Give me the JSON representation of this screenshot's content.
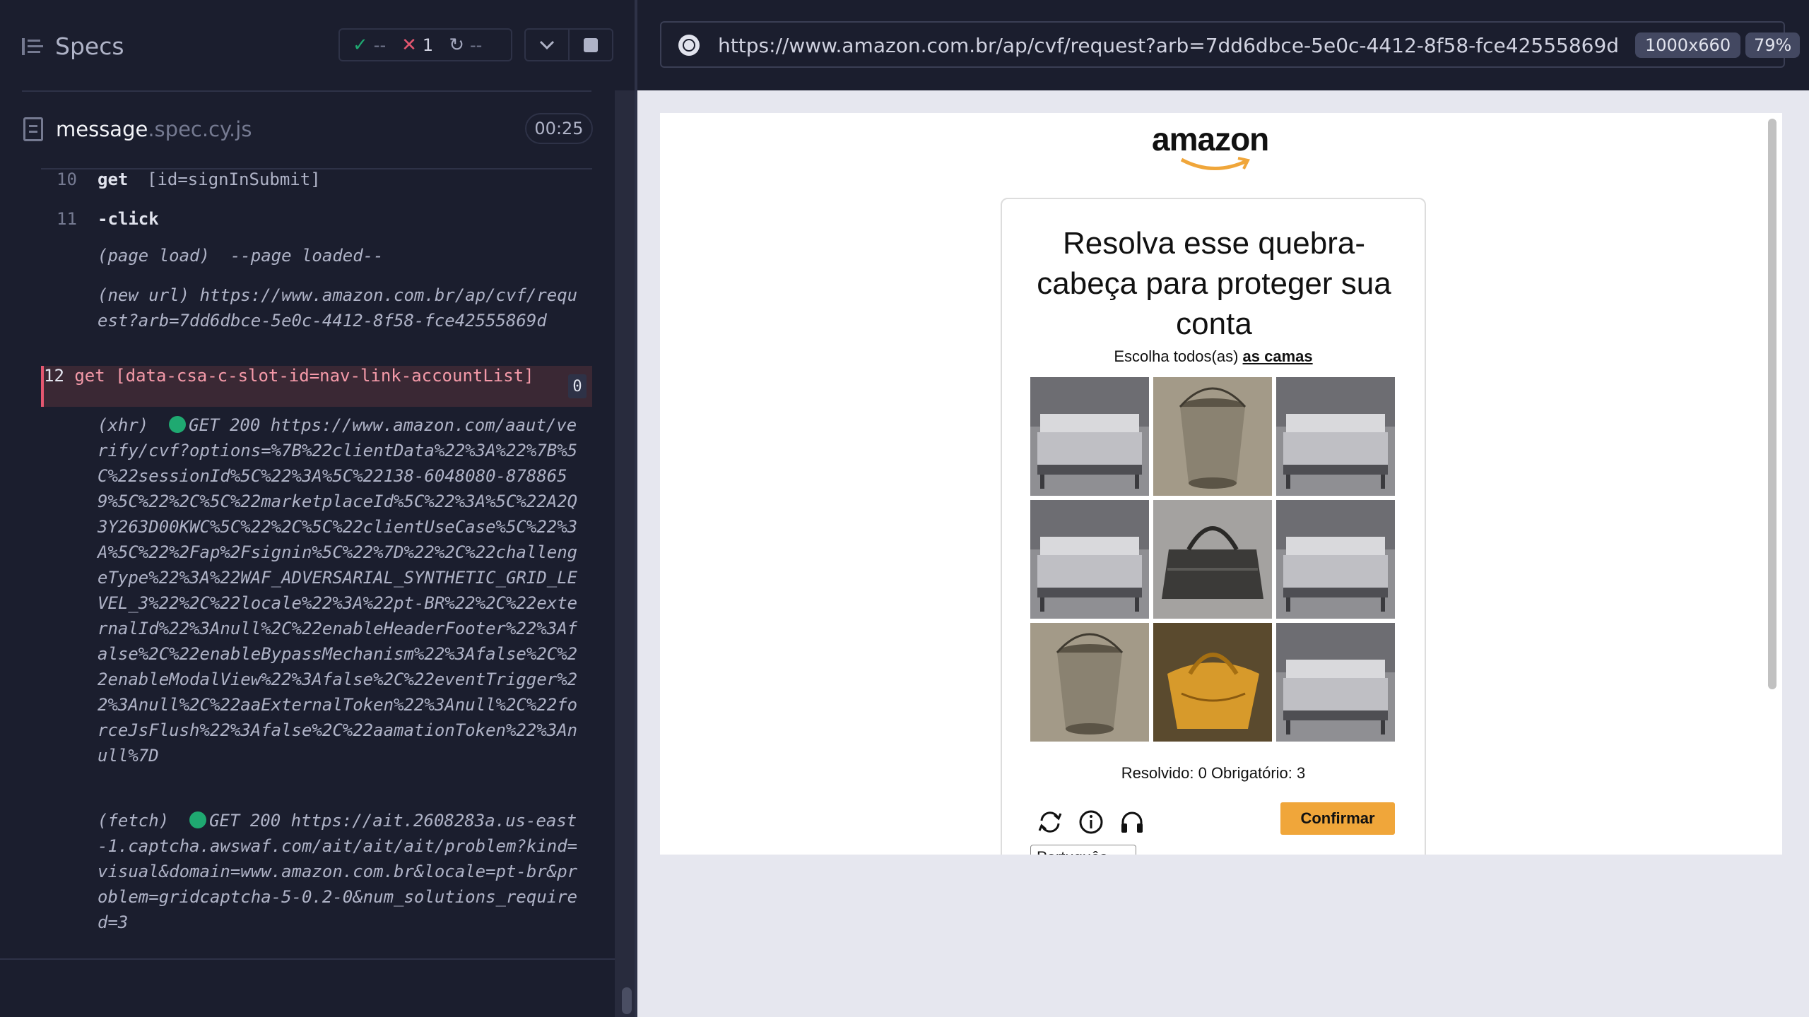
{
  "reporter": {
    "specs_label": "Specs",
    "stats": {
      "passed": "--",
      "failed": "1",
      "pending": "--"
    },
    "spec_file": {
      "name": "message",
      "ext": ".spec.cy.js",
      "duration": "00:25"
    }
  },
  "commands": [
    {
      "num": "10",
      "name": "get",
      "arg": "[id=signInSubmit]"
    },
    {
      "num": "11",
      "name": "-click",
      "arg": ""
    },
    {
      "num": "12",
      "name": "get",
      "arg": "[data-csa-c-slot-id=nav-link-accountList]",
      "badge": "0"
    }
  ],
  "messages": {
    "page_load": "(page load)  --page loaded--",
    "new_url_label": "(new url)",
    "new_url": "https://www.amazon.com.br/ap/cvf/request?arb=7dd6dbce-5e0c-4412-8f58-fce42555869d",
    "xhr_label": "(xhr)",
    "xhr_status": "GET 200",
    "xhr_url": "https://www.amazon.com/aaut/verify/cvf?options=%7B%22clientData%22%3A%22%7B%5C%22sessionId%5C%22%3A%5C%22138-6048080-8788659%5C%22%2C%5C%22marketplaceId%5C%22%3A%5C%22A2Q3Y263D00KWC%5C%22%2C%5C%22clientUseCase%5C%22%3A%5C%22%2Fap%2Fsignin%5C%22%7D%22%2C%22challengeType%22%3A%22WAF_ADVERSARIAL_SYNTHETIC_GRID_LEVEL_3%22%2C%22locale%22%3A%22pt-BR%22%2C%22externalId%22%3Anull%2C%22enableHeaderFooter%22%3Afalse%2C%22enableBypassMechanism%22%3Afalse%2C%22enableModalView%22%3Afalse%2C%22eventTrigger%22%3Anull%2C%22aaExternalToken%22%3Anull%2C%22forceJsFlush%22%3Afalse%2C%22aamationToken%22%3Anull%7D",
    "fetch_label": "(fetch)",
    "fetch_text": "GET 200 https://ait.2608283a.us-east-1.captcha.awswaf.com/ait/ait/ait/problem?kind=visual&domain=www.amazon.com.br&locale=pt-br&problem=gridcaptcha-5-0.2-0&num_solutions_required=3"
  },
  "aut": {
    "url": "https://www.amazon.com.br/ap/cvf/request?arb=7dd6dbce-5e0c-4412-8f58-fce42555869d",
    "viewport": "1000x660",
    "zoom": "79%"
  },
  "captcha": {
    "logo": "amazon",
    "title": "Resolva esse quebra-cabeça para proteger sua conta",
    "subtitle_prefix": "Escolha todos(as) ",
    "subtitle_target": "as camas",
    "tiles": [
      "bed",
      "bucket",
      "bed",
      "bed",
      "bag",
      "bed",
      "bucket",
      "bag",
      "bed"
    ],
    "status": "Resolvido: 0 Obrigatório: 3",
    "confirm": "Confirmar",
    "language": "Português"
  },
  "colors": {
    "pass": "#1fa971",
    "fail": "#e45770",
    "confirm": "#f0a63a"
  }
}
